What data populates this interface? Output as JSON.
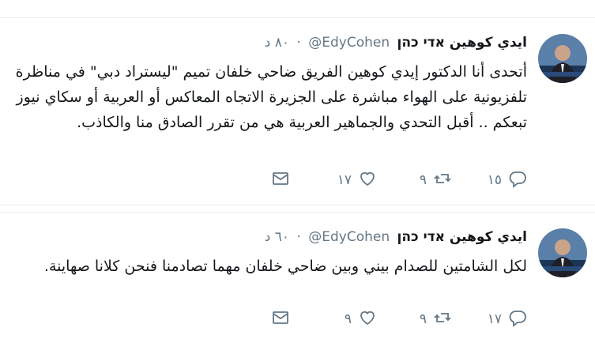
{
  "tweets": [
    {
      "name": "ايدي كوهين אדי כהן",
      "handle": "@EdyCohen",
      "time": "٨٠ د",
      "text": "أتحدى أنا الدكتور إيدي كوهين الفريق ضاحي خلفان تميم \"ليستراد دبي\" في مناظرة تلفزيونية على الهواء مباشرة على الجزيرة الاتجاه المعاكس أو العربية  أو سكاي نيوز تبعكم .. أقبل التحدي والجماهير العربية هي من تقرر الصادق منا والكاذب.",
      "replies": "١٥",
      "retweets": "٩",
      "likes": "١٧",
      "icons": {
        "reply": "reply-icon",
        "retweet": "retweet-icon",
        "like": "heart-icon",
        "dm": "mail-icon"
      }
    },
    {
      "name": "ايدي كوهين אדי כהן",
      "handle": "@EdyCohen",
      "time": "٦٠ د",
      "text": "لكل الشامتين للصدام بيني وبين ضاحي خلفان مهما تصادمنا فنحن كلانا صهاينة.",
      "replies": "١٧",
      "retweets": "٩",
      "likes": "٩",
      "icons": {
        "reply": "reply-icon",
        "retweet": "retweet-icon",
        "like": "heart-icon",
        "dm": "mail-icon"
      }
    }
  ],
  "colors": {
    "text": "#14171a",
    "muted": "#657786",
    "border": "#e6ecf0"
  }
}
